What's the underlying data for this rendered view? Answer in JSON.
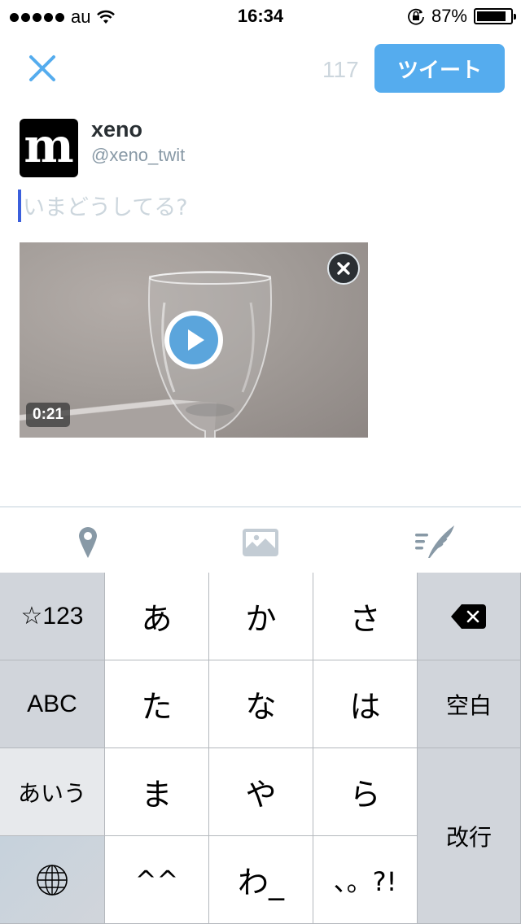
{
  "status_bar": {
    "carrier": "au",
    "time": "16:34",
    "battery_percent": "87%",
    "battery_level": 0.87
  },
  "header": {
    "close_icon": "close-icon",
    "char_count": "117",
    "tweet_label": "ツイート",
    "accent_color": "#55acee"
  },
  "profile": {
    "avatar_letter": "m",
    "display_name": "xeno",
    "handle": "@xeno_twit"
  },
  "compose": {
    "value": "",
    "placeholder": "いまどうしてる?"
  },
  "media": {
    "type": "video",
    "duration": "0:21",
    "play_icon": "play-icon",
    "remove_icon": "close-circle-icon"
  },
  "toolbar": {
    "items": [
      {
        "name": "location",
        "icon": "map-pin-icon"
      },
      {
        "name": "photo",
        "icon": "image-icon"
      },
      {
        "name": "drafts",
        "icon": "drafts-quill-icon"
      }
    ]
  },
  "keyboard": {
    "left_column": [
      "☆123",
      "ABC",
      "あいう",
      "globe-icon"
    ],
    "kana_rows": [
      [
        "あ",
        "か",
        "さ"
      ],
      [
        "た",
        "な",
        "は"
      ],
      [
        "ま",
        "や",
        "ら"
      ],
      [
        "^^",
        "わ_",
        "、。?!"
      ]
    ],
    "delete_icon": "backspace-icon",
    "space_label": "空白",
    "return_label": "改行"
  }
}
